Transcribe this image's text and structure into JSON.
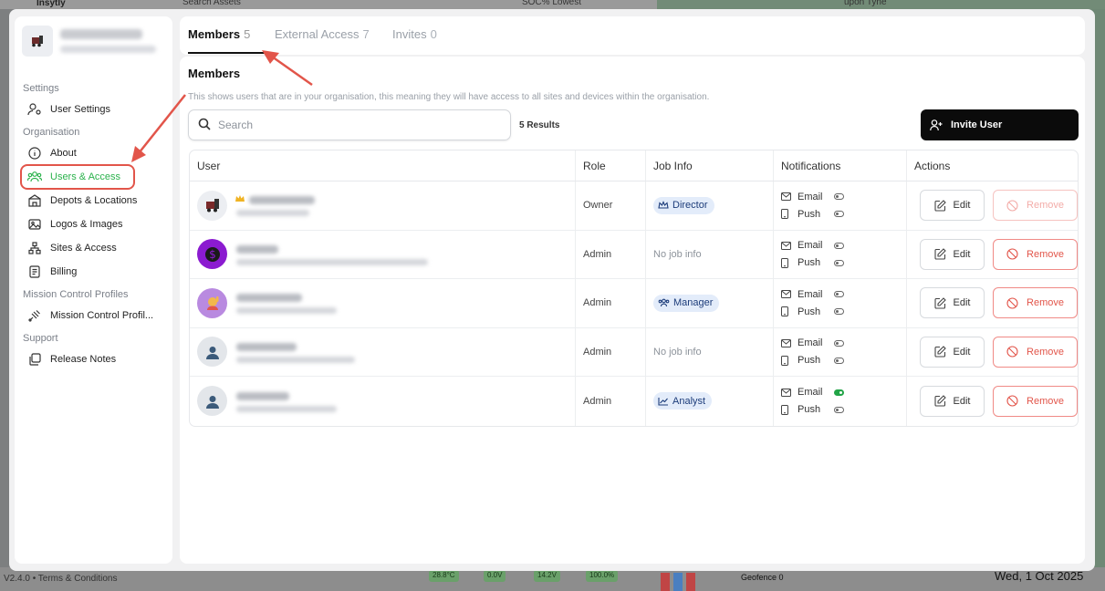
{
  "background": {
    "brand": "Insytly",
    "search_placeholder": "Search Assets",
    "soc_label": "SOC% Lowest",
    "map_label": "upon Tyne",
    "version": "V2.4.0 • Terms & Conditions",
    "date": "Wed, 1 Oct 2025",
    "geofence_label": "Geofence",
    "geofence_value": "0",
    "chips": [
      "28.8°C",
      "0.0V",
      "14.2V",
      "100.0%"
    ]
  },
  "sidebar": {
    "sections": {
      "settings": "Settings",
      "organisation": "Organisation",
      "mission": "Mission Control Profiles",
      "support": "Support"
    },
    "items": {
      "user_settings": "User Settings",
      "about": "About",
      "users_access": "Users & Access",
      "depots": "Depots & Locations",
      "logos": "Logos & Images",
      "sites": "Sites & Access",
      "billing": "Billing",
      "mission_profiles": "Mission Control Profil...",
      "release_notes": "Release Notes"
    },
    "active_color": "#2bb24c"
  },
  "tabs": [
    {
      "label": "Members",
      "count": "5"
    },
    {
      "label": "External Access",
      "count": "7"
    },
    {
      "label": "Invites",
      "count": "0"
    }
  ],
  "main": {
    "title": "Members",
    "description": "This shows users that are in your organisation, this meaning they will have access to all sites and devices within the organisation.",
    "search_placeholder": "Search",
    "results": "5 Results",
    "invite_label": "Invite User"
  },
  "table": {
    "headers": [
      "User",
      "Role",
      "Job Info",
      "Notifications",
      "Actions"
    ],
    "email_label": "Email",
    "push_label": "Push",
    "edit_label": "Edit",
    "remove_label": "Remove",
    "rows": [
      {
        "role": "Owner",
        "job": "Director",
        "job_icon": "crown-icon",
        "avatar": "train",
        "email_on": false,
        "push_on": false,
        "remove_enabled": false
      },
      {
        "role": "Admin",
        "job": "No job info",
        "job_icon": "",
        "avatar": "dollar",
        "email_on": false,
        "push_on": false,
        "remove_enabled": true
      },
      {
        "role": "Admin",
        "job": "Manager",
        "job_icon": "users-icon",
        "avatar": "person-raising-hand",
        "email_on": false,
        "push_on": false,
        "remove_enabled": true
      },
      {
        "role": "Admin",
        "job": "No job info",
        "job_icon": "",
        "avatar": "default",
        "email_on": false,
        "push_on": false,
        "remove_enabled": true
      },
      {
        "role": "Admin",
        "job": "Analyst",
        "job_icon": "chart-icon",
        "avatar": "default",
        "email_on": true,
        "push_on": false,
        "remove_enabled": true
      }
    ]
  },
  "colors": {
    "accent_green": "#22a447",
    "remove_red": "#e2554a",
    "annotation_red": "#e2554a",
    "pill_bg": "#e3ecfa"
  }
}
